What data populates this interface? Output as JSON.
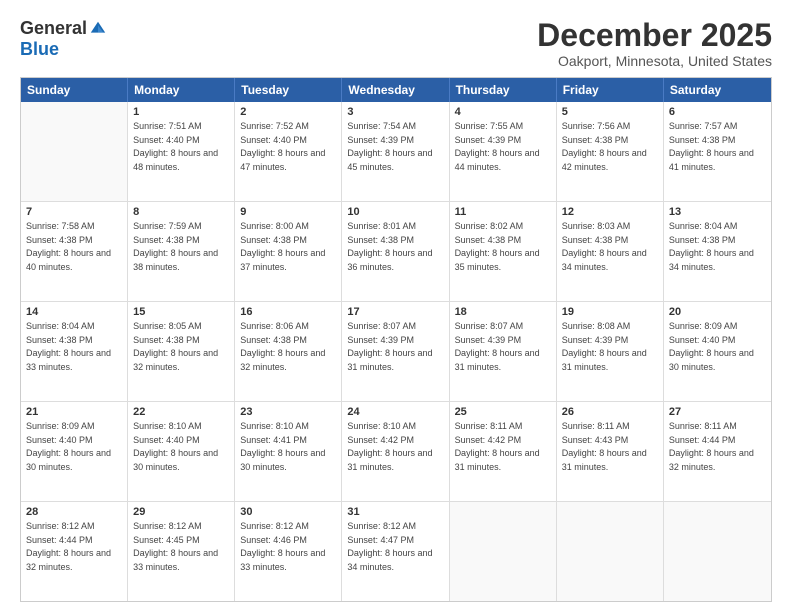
{
  "logo": {
    "general": "General",
    "blue": "Blue"
  },
  "title": "December 2025",
  "location": "Oakport, Minnesota, United States",
  "days_of_week": [
    "Sunday",
    "Monday",
    "Tuesday",
    "Wednesday",
    "Thursday",
    "Friday",
    "Saturday"
  ],
  "weeks": [
    [
      {
        "day": "",
        "sunrise": "",
        "sunset": "",
        "daylight": ""
      },
      {
        "day": "1",
        "sunrise": "7:51 AM",
        "sunset": "4:40 PM",
        "daylight": "8 hours and 48 minutes."
      },
      {
        "day": "2",
        "sunrise": "7:52 AM",
        "sunset": "4:40 PM",
        "daylight": "8 hours and 47 minutes."
      },
      {
        "day": "3",
        "sunrise": "7:54 AM",
        "sunset": "4:39 PM",
        "daylight": "8 hours and 45 minutes."
      },
      {
        "day": "4",
        "sunrise": "7:55 AM",
        "sunset": "4:39 PM",
        "daylight": "8 hours and 44 minutes."
      },
      {
        "day": "5",
        "sunrise": "7:56 AM",
        "sunset": "4:38 PM",
        "daylight": "8 hours and 42 minutes."
      },
      {
        "day": "6",
        "sunrise": "7:57 AM",
        "sunset": "4:38 PM",
        "daylight": "8 hours and 41 minutes."
      }
    ],
    [
      {
        "day": "7",
        "sunrise": "7:58 AM",
        "sunset": "4:38 PM",
        "daylight": "8 hours and 40 minutes."
      },
      {
        "day": "8",
        "sunrise": "7:59 AM",
        "sunset": "4:38 PM",
        "daylight": "8 hours and 38 minutes."
      },
      {
        "day": "9",
        "sunrise": "8:00 AM",
        "sunset": "4:38 PM",
        "daylight": "8 hours and 37 minutes."
      },
      {
        "day": "10",
        "sunrise": "8:01 AM",
        "sunset": "4:38 PM",
        "daylight": "8 hours and 36 minutes."
      },
      {
        "day": "11",
        "sunrise": "8:02 AM",
        "sunset": "4:38 PM",
        "daylight": "8 hours and 35 minutes."
      },
      {
        "day": "12",
        "sunrise": "8:03 AM",
        "sunset": "4:38 PM",
        "daylight": "8 hours and 34 minutes."
      },
      {
        "day": "13",
        "sunrise": "8:04 AM",
        "sunset": "4:38 PM",
        "daylight": "8 hours and 34 minutes."
      }
    ],
    [
      {
        "day": "14",
        "sunrise": "8:04 AM",
        "sunset": "4:38 PM",
        "daylight": "8 hours and 33 minutes."
      },
      {
        "day": "15",
        "sunrise": "8:05 AM",
        "sunset": "4:38 PM",
        "daylight": "8 hours and 32 minutes."
      },
      {
        "day": "16",
        "sunrise": "8:06 AM",
        "sunset": "4:38 PM",
        "daylight": "8 hours and 32 minutes."
      },
      {
        "day": "17",
        "sunrise": "8:07 AM",
        "sunset": "4:39 PM",
        "daylight": "8 hours and 31 minutes."
      },
      {
        "day": "18",
        "sunrise": "8:07 AM",
        "sunset": "4:39 PM",
        "daylight": "8 hours and 31 minutes."
      },
      {
        "day": "19",
        "sunrise": "8:08 AM",
        "sunset": "4:39 PM",
        "daylight": "8 hours and 31 minutes."
      },
      {
        "day": "20",
        "sunrise": "8:09 AM",
        "sunset": "4:40 PM",
        "daylight": "8 hours and 30 minutes."
      }
    ],
    [
      {
        "day": "21",
        "sunrise": "8:09 AM",
        "sunset": "4:40 PM",
        "daylight": "8 hours and 30 minutes."
      },
      {
        "day": "22",
        "sunrise": "8:10 AM",
        "sunset": "4:40 PM",
        "daylight": "8 hours and 30 minutes."
      },
      {
        "day": "23",
        "sunrise": "8:10 AM",
        "sunset": "4:41 PM",
        "daylight": "8 hours and 30 minutes."
      },
      {
        "day": "24",
        "sunrise": "8:10 AM",
        "sunset": "4:42 PM",
        "daylight": "8 hours and 31 minutes."
      },
      {
        "day": "25",
        "sunrise": "8:11 AM",
        "sunset": "4:42 PM",
        "daylight": "8 hours and 31 minutes."
      },
      {
        "day": "26",
        "sunrise": "8:11 AM",
        "sunset": "4:43 PM",
        "daylight": "8 hours and 31 minutes."
      },
      {
        "day": "27",
        "sunrise": "8:11 AM",
        "sunset": "4:44 PM",
        "daylight": "8 hours and 32 minutes."
      }
    ],
    [
      {
        "day": "28",
        "sunrise": "8:12 AM",
        "sunset": "4:44 PM",
        "daylight": "8 hours and 32 minutes."
      },
      {
        "day": "29",
        "sunrise": "8:12 AM",
        "sunset": "4:45 PM",
        "daylight": "8 hours and 33 minutes."
      },
      {
        "day": "30",
        "sunrise": "8:12 AM",
        "sunset": "4:46 PM",
        "daylight": "8 hours and 33 minutes."
      },
      {
        "day": "31",
        "sunrise": "8:12 AM",
        "sunset": "4:47 PM",
        "daylight": "8 hours and 34 minutes."
      },
      {
        "day": "",
        "sunrise": "",
        "sunset": "",
        "daylight": ""
      },
      {
        "day": "",
        "sunrise": "",
        "sunset": "",
        "daylight": ""
      },
      {
        "day": "",
        "sunrise": "",
        "sunset": "",
        "daylight": ""
      }
    ]
  ]
}
